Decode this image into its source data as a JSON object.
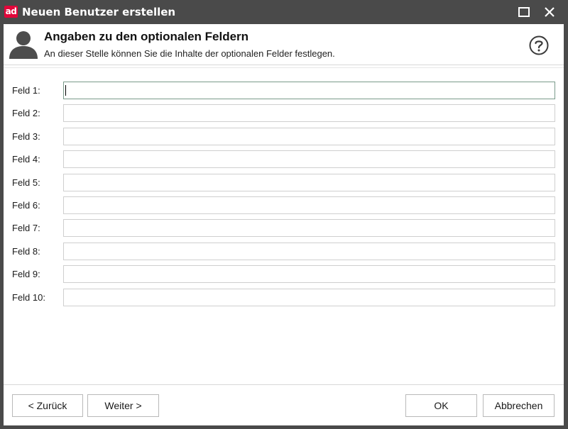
{
  "window": {
    "title": "Neuen Benutzer erstellen",
    "logo_text": "ad",
    "logo_color": "#e2063a",
    "titlebar_color": "#4a4a4a",
    "maximize_icon": "maximize-icon",
    "close_icon": "close-icon"
  },
  "header": {
    "title": "Angaben zu den optionalen Feldern",
    "subtitle": "An dieser Stelle können Sie die Inhalte der optionalen Felder festlegen.",
    "user_icon": "user-icon",
    "help_icon": "help-icon"
  },
  "fields": [
    {
      "label": "Feld 1:",
      "value": "",
      "focused": true
    },
    {
      "label": "Feld 2:",
      "value": ""
    },
    {
      "label": "Feld 3:",
      "value": ""
    },
    {
      "label": "Feld 4:",
      "value": ""
    },
    {
      "label": "Feld 5:",
      "value": ""
    },
    {
      "label": "Feld 6:",
      "value": ""
    },
    {
      "label": "Feld 7:",
      "value": ""
    },
    {
      "label": "Feld 8:",
      "value": ""
    },
    {
      "label": "Feld 9:",
      "value": ""
    },
    {
      "label": "Feld 10:",
      "value": ""
    }
  ],
  "footer": {
    "back_label": "< Zurück",
    "next_label": "Weiter >",
    "ok_label": "OK",
    "cancel_label": "Abbrechen"
  }
}
